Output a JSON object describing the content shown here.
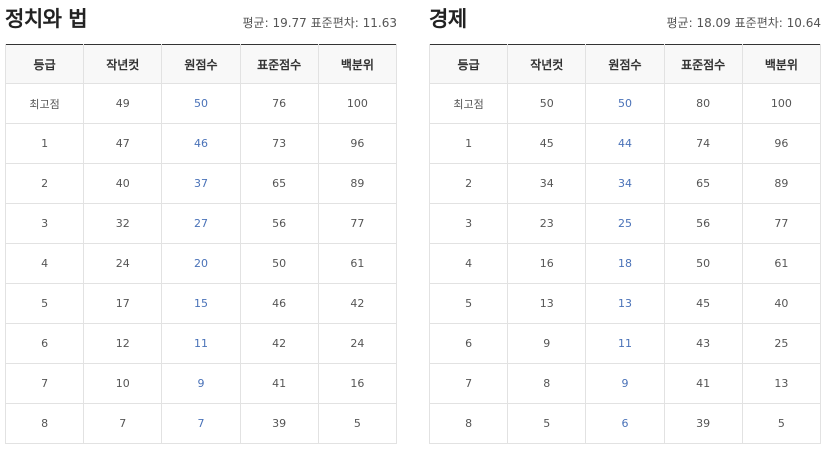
{
  "headers": [
    "등급",
    "작년컷",
    "원점수",
    "표준점수",
    "백분위"
  ],
  "left": {
    "title": "정치와 법",
    "stats": "평균: 19.77 표준편차: 11.63",
    "rows": [
      [
        "최고점",
        "49",
        "50",
        "76",
        "100"
      ],
      [
        "1",
        "47",
        "46",
        "73",
        "96"
      ],
      [
        "2",
        "40",
        "37",
        "65",
        "89"
      ],
      [
        "3",
        "32",
        "27",
        "56",
        "77"
      ],
      [
        "4",
        "24",
        "20",
        "50",
        "61"
      ],
      [
        "5",
        "17",
        "15",
        "46",
        "42"
      ],
      [
        "6",
        "12",
        "11",
        "42",
        "24"
      ],
      [
        "7",
        "10",
        "9",
        "41",
        "16"
      ],
      [
        "8",
        "7",
        "7",
        "39",
        "5"
      ]
    ]
  },
  "right": {
    "title": "경제",
    "stats": "평균: 18.09 표준편차: 10.64",
    "rows": [
      [
        "최고점",
        "50",
        "50",
        "80",
        "100"
      ],
      [
        "1",
        "45",
        "44",
        "74",
        "96"
      ],
      [
        "2",
        "34",
        "34",
        "65",
        "89"
      ],
      [
        "3",
        "23",
        "25",
        "56",
        "77"
      ],
      [
        "4",
        "16",
        "18",
        "50",
        "61"
      ],
      [
        "5",
        "13",
        "13",
        "45",
        "40"
      ],
      [
        "6",
        "9",
        "11",
        "43",
        "25"
      ],
      [
        "7",
        "8",
        "9",
        "41",
        "13"
      ],
      [
        "8",
        "5",
        "6",
        "39",
        "5"
      ]
    ]
  },
  "colors": {
    "raw_score": "#4a72b8",
    "header_bg": "#f8f8f8",
    "table_top_border": "#333333"
  }
}
